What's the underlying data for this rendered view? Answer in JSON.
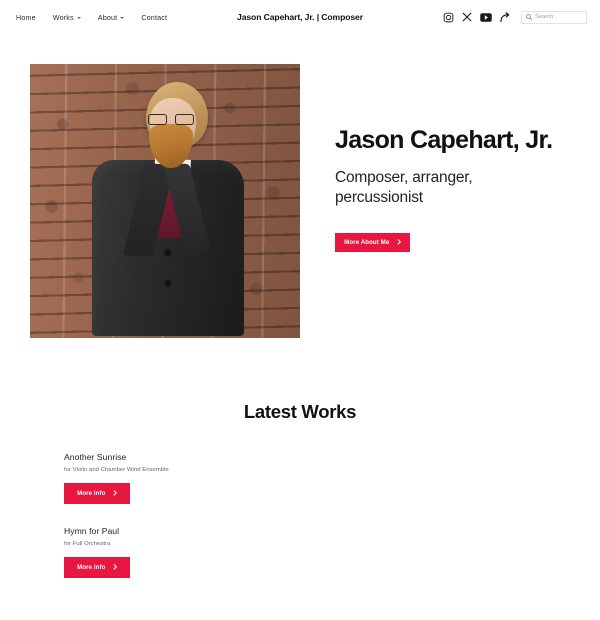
{
  "header": {
    "nav": [
      {
        "label": "Home",
        "has_dropdown": false
      },
      {
        "label": "Works",
        "has_dropdown": true
      },
      {
        "label": "About",
        "has_dropdown": true
      },
      {
        "label": "Contact",
        "has_dropdown": false
      }
    ],
    "brand_title": "Jason Capehart, Jr. | Composer",
    "social": [
      {
        "name": "instagram-icon"
      },
      {
        "name": "x-twitter-icon"
      },
      {
        "name": "youtube-icon"
      },
      {
        "name": "share-icon"
      }
    ],
    "search": {
      "placeholder": "Search",
      "value": "",
      "icon": "search-icon"
    }
  },
  "hero": {
    "photo_alt": "Portrait of Jason Capehart, Jr. standing against a brick wall",
    "title": "Jason Capehart, Jr.",
    "subtitle": "Composer, arranger, percussionist",
    "cta_label": "More About Me"
  },
  "works": {
    "heading": "Latest Works",
    "items": [
      {
        "title": "Another Sunrise",
        "subtitle": "for Violin and Chamber Wind Ensemble",
        "cta_label": "More Info"
      },
      {
        "title": "Hymn for Paul",
        "subtitle": "for Full Orchestra",
        "cta_label": "More Info"
      }
    ]
  },
  "colors": {
    "accent": "#E8173F",
    "text": "#1a1a1a",
    "muted": "#666666",
    "background": "#ffffff"
  }
}
